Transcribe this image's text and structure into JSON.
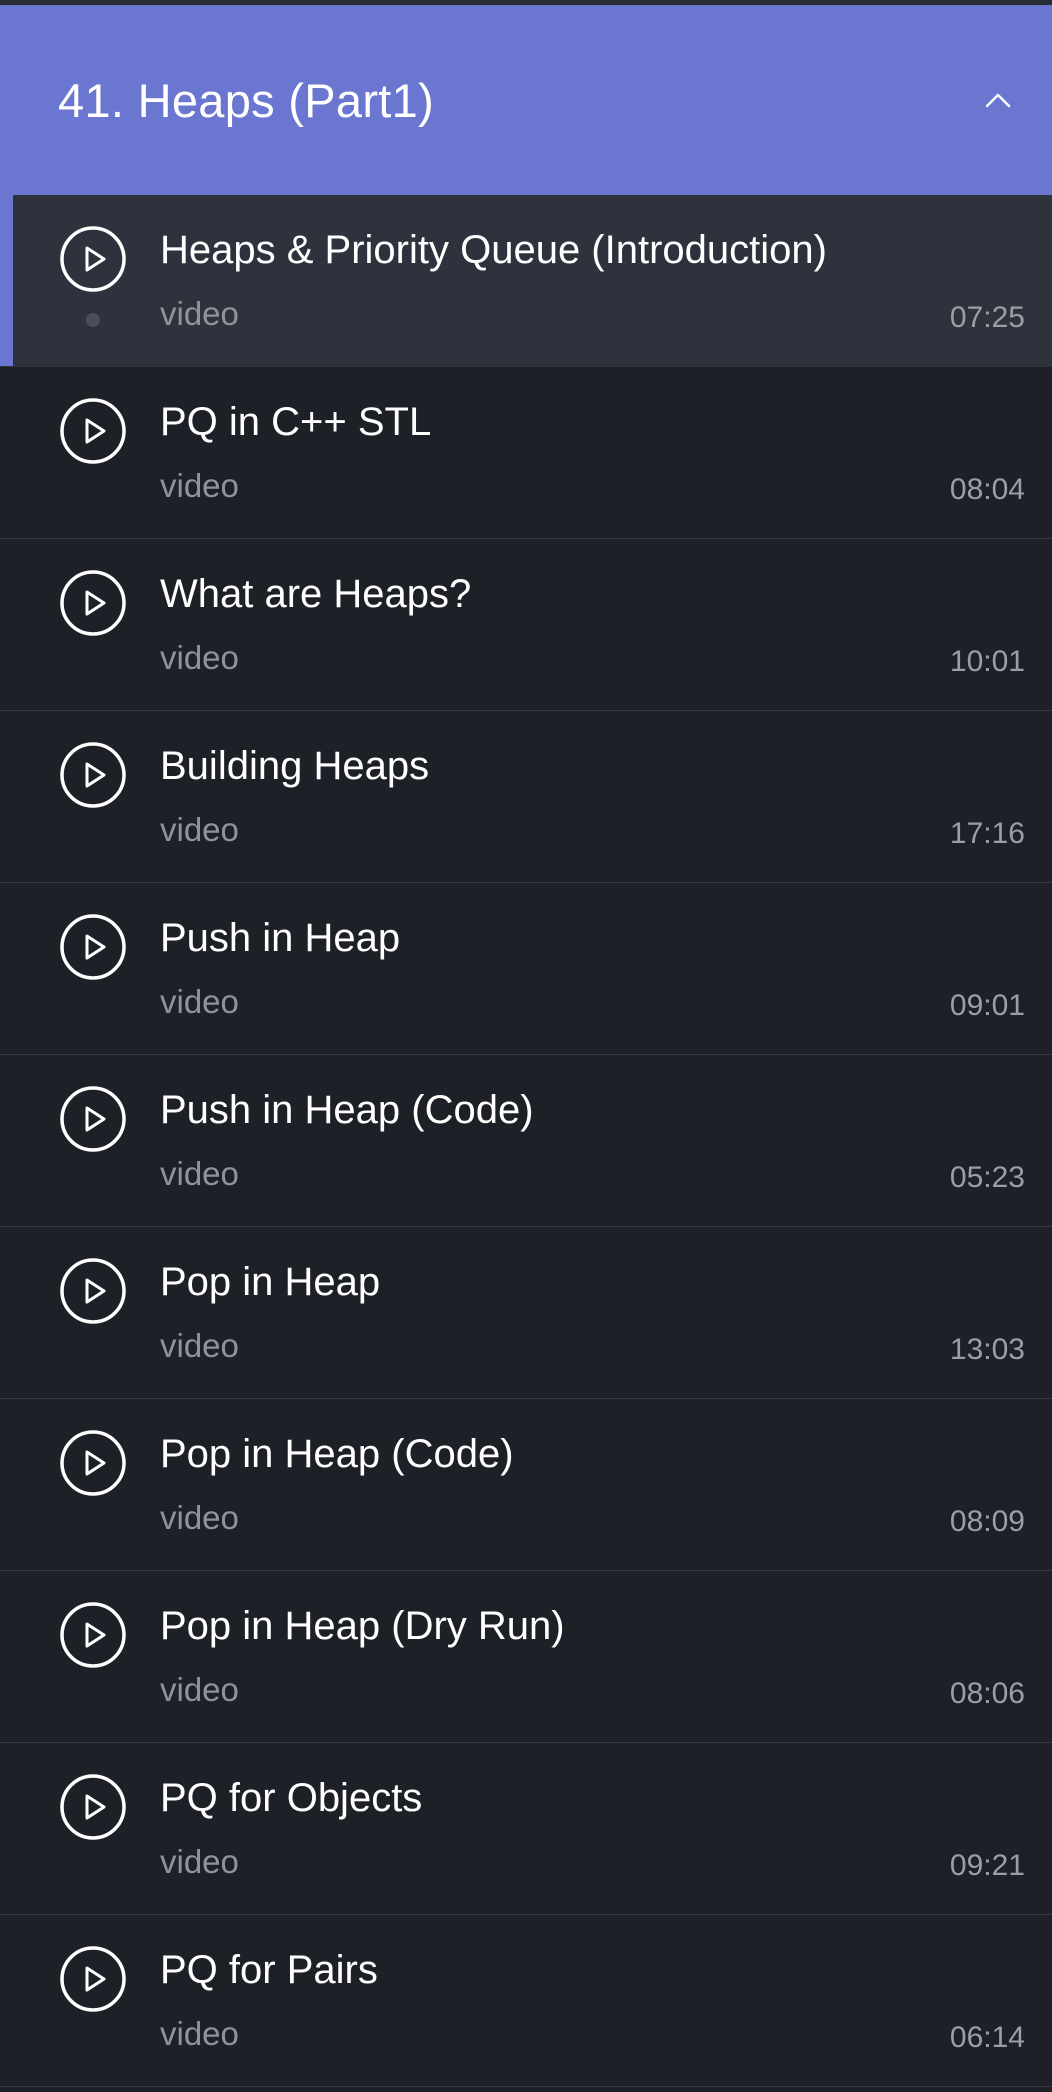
{
  "section": {
    "title": "41. Heaps (Part1)",
    "expanded": true,
    "chevron_icon": "chevron-up-icon",
    "accent_color": "#6a76cf"
  },
  "lessons": [
    {
      "title": "Heaps & Priority Queue (Introduction)",
      "type": "video",
      "duration": "07:25",
      "active": true
    },
    {
      "title": "PQ in C++ STL",
      "type": "video",
      "duration": "08:04"
    },
    {
      "title": "What are Heaps?",
      "type": "video",
      "duration": "10:01"
    },
    {
      "title": "Building Heaps",
      "type": "video",
      "duration": "17:16"
    },
    {
      "title": "Push in Heap",
      "type": "video",
      "duration": "09:01"
    },
    {
      "title": "Push in Heap (Code)",
      "type": "video",
      "duration": "05:23"
    },
    {
      "title": "Pop in Heap",
      "type": "video",
      "duration": "13:03"
    },
    {
      "title": "Pop in Heap (Code)",
      "type": "video",
      "duration": "08:09"
    },
    {
      "title": "Pop in Heap (Dry Run)",
      "type": "video",
      "duration": "08:06"
    },
    {
      "title": "PQ for Objects",
      "type": "video",
      "duration": "09:21"
    },
    {
      "title": "PQ for Pairs",
      "type": "video",
      "duration": "06:14"
    }
  ],
  "icons": {
    "lesson": "play-circle-icon"
  }
}
